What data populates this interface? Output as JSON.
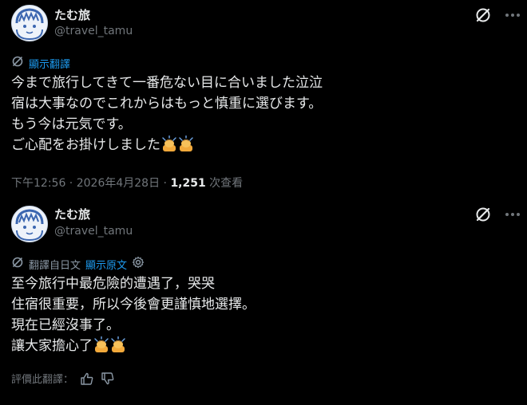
{
  "post": {
    "display_name": "たむ旅",
    "handle": "@travel_tamu",
    "show_translation_label": "顯示翻譯",
    "lines": [
      "今まで旅行してきて一番危ない目に合いました泣泣",
      "宿は大事なのでこれからはもっと慎重に選びます。",
      "もう今は元気です。",
      "ご心配をお掛けしました"
    ],
    "time": "下午12:56",
    "separator1": " · ",
    "date": "2026年4月28日",
    "separator2": " · ",
    "views_count": "1,251",
    "views_label": " 次查看"
  },
  "translation": {
    "display_name": "たむ旅",
    "handle": "@travel_tamu",
    "translated_from_label": "翻譯自日文",
    "show_original_label": "顯示原文",
    "lines": [
      "至今旅行中最危險的遭遇了，哭哭",
      "住宿很重要，所以今後會更謹慎地選擇。",
      "現在已經沒事了。",
      "讓大家擔心了"
    ],
    "rate_label": "評價此翻譯："
  },
  "icons": {
    "translate": "translate-icon",
    "grok": "grok-icon",
    "more": "more-options-icon",
    "settings": "gear-icon",
    "thumb_up": "thumbs-up-icon",
    "thumb_down": "thumbs-down-icon",
    "emoji": "person-bowing-emoji"
  },
  "colors": {
    "background": "#000000",
    "text": "#e7e9ea",
    "muted": "#71767b",
    "link": "#1d9bf0"
  }
}
